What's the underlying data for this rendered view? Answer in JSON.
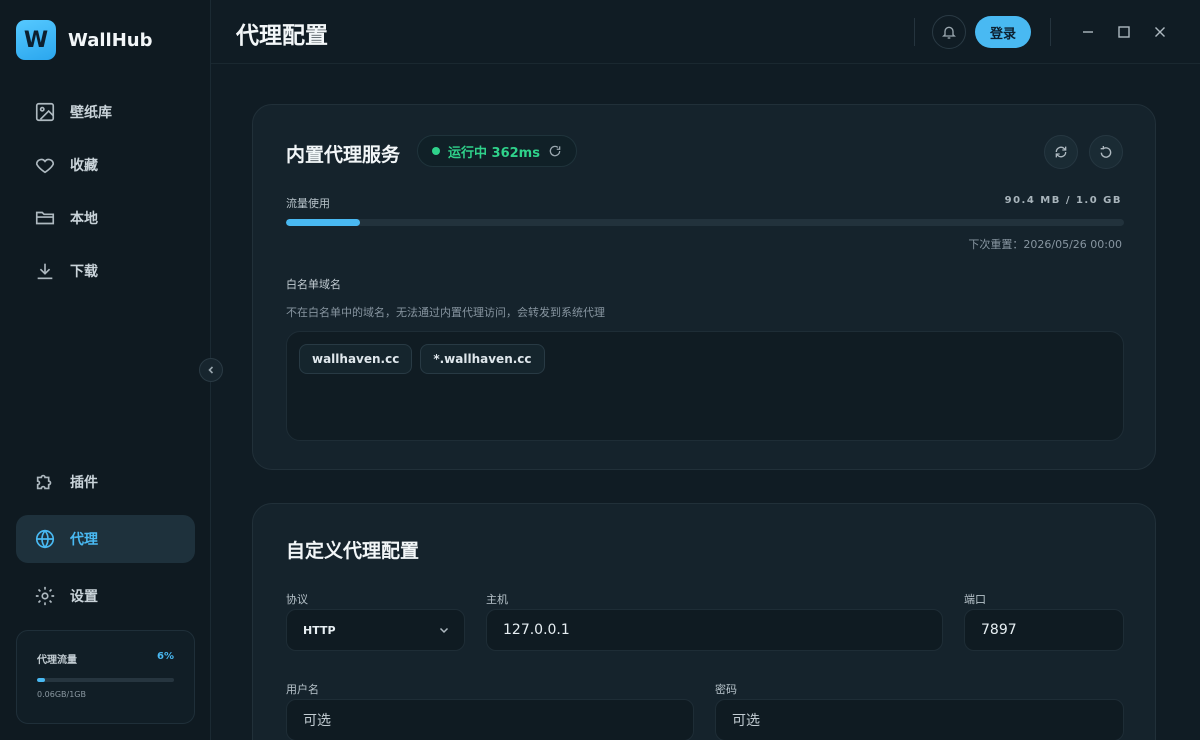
{
  "app": {
    "name": "WallHub",
    "logo_letter": "W"
  },
  "sidebar": {
    "top_items": [
      {
        "label": "壁纸库",
        "icon": "image-icon"
      },
      {
        "label": "收藏",
        "icon": "heart-icon"
      },
      {
        "label": "本地",
        "icon": "folder-icon"
      },
      {
        "label": "下载",
        "icon": "download-icon"
      }
    ],
    "bottom_items": [
      {
        "label": "插件",
        "icon": "puzzle-icon"
      },
      {
        "label": "代理",
        "icon": "globe-icon",
        "active": true
      },
      {
        "label": "设置",
        "icon": "gear-icon"
      }
    ],
    "traffic": {
      "label": "代理流量",
      "percent_label": "6%",
      "percent": 6,
      "detail": "0.06GB/1GB"
    }
  },
  "header": {
    "title": "代理配置",
    "login_label": "登录"
  },
  "builtin": {
    "title": "内置代理服务",
    "status_label": "运行中 362ms",
    "usage_label": "流量使用",
    "usage_value": "90.4 MB / 1.0 GB",
    "usage_fraction": 0.088,
    "reset_text": "下次重置：2026/05/26 00:00",
    "whitelist_title": "白名单域名",
    "whitelist_desc": "不在白名单中的域名，无法通过内置代理访问，会转发到系统代理",
    "domains": [
      "wallhaven.cc",
      "*.wallhaven.cc"
    ]
  },
  "custom": {
    "title": "自定义代理配置",
    "protocol_label": "协议",
    "protocol_value": "HTTP",
    "host_label": "主机",
    "host_value": "127.0.0.1",
    "port_label": "端口",
    "port_value": "7897",
    "username_label": "用户名",
    "username_placeholder": "可选",
    "password_label": "密码",
    "password_placeholder": "可选"
  },
  "colors": {
    "accent": "#49b9f2",
    "success": "#2fd28b",
    "background": "#101c24"
  }
}
